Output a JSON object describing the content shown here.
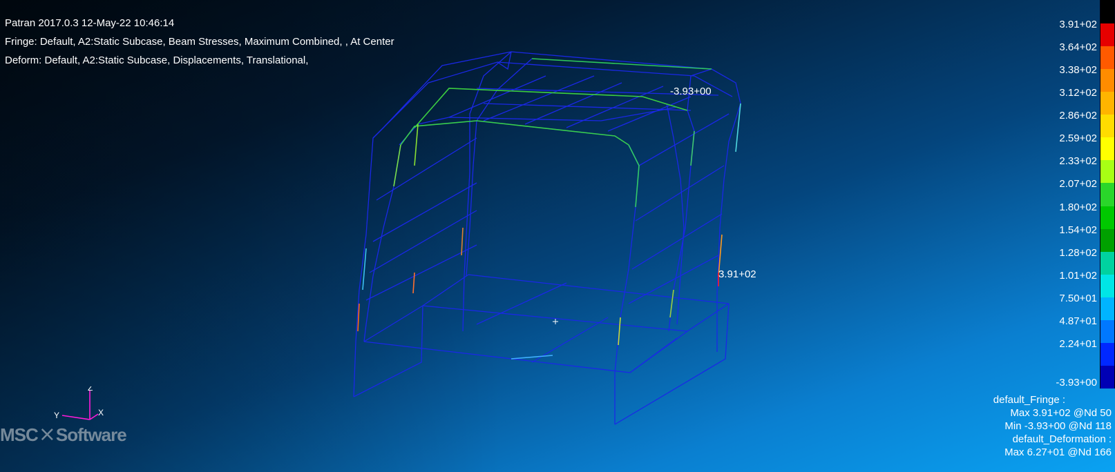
{
  "header": {
    "line1": "Patran 2017.0.3 12-May-22 10:46:14",
    "line2": "Fringe: Default, A2:Static Subcase, Beam Stresses, Maximum Combined, , At Center",
    "line3": "Deform: Default, A2:Static Subcase, Displacements, Translational,"
  },
  "legend": {
    "labels": [
      "3.91+02",
      "3.64+02",
      "3.38+02",
      "3.12+02",
      "2.86+02",
      "2.59+02",
      "2.33+02",
      "2.07+02",
      "1.80+02",
      "1.54+02",
      "1.28+02",
      "1.01+02",
      "7.50+01",
      "4.87+01",
      "2.24+01",
      "-3.93+00"
    ],
    "colors": [
      "#e60000",
      "#ff5a00",
      "#ff8c00",
      "#ffb400",
      "#ffdc00",
      "#ffff00",
      "#a8ff14",
      "#2ad62a",
      "#00c800",
      "#00a000",
      "#00d2a0",
      "#00e6e6",
      "#00b4ff",
      "#0078ff",
      "#0028ff",
      "#0000b4"
    ]
  },
  "summary": {
    "line1": "default_Fringe :",
    "line2": "Max 3.91+02 @Nd 50",
    "line3": "Min -3.93+00 @Nd 118",
    "line4": "default_Deformation :",
    "line5": "Max 6.27+01 @Nd 166"
  },
  "annotations": {
    "min_label": "-3.93+00",
    "max_label": "3.91+02"
  },
  "triad": {
    "z": "Z",
    "y": "Y",
    "x": "X"
  },
  "logo": {
    "part1": "MSC",
    "part2": "Software"
  }
}
